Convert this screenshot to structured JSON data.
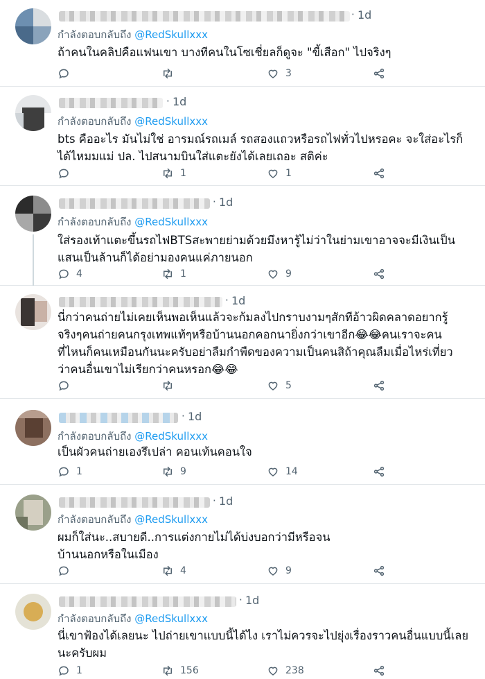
{
  "reply_prefix": "กำลังตอบกลับถึง",
  "reply_handle": "@RedSkullxxx",
  "icons": {
    "reply": "reply-icon",
    "retweet": "retweet-icon",
    "like": "heart-icon",
    "share": "share-icon"
  },
  "colors": {
    "handle": "#1d9bf0",
    "meta": "#536471",
    "text": "#0f1419",
    "divider": "#e3e7ea"
  },
  "tweets": [
    {
      "time": "1d",
      "text": "ถ้าคนในคลิปคือแฟนเขา บางทีคนในโซเชี่ยลก็ดูจะ \"ขี้เสือก\" ไปจริงๆ",
      "replies": "",
      "retweets": "",
      "likes": "3"
    },
    {
      "time": "1d",
      "text": "bts คืออะไร มันไม่ใช่ อารมณ์รถเมล์ รถสองแถวหรือรถไฟทั่วไปหรอคะ จะใส่อะไรก็\nได้ไหมมแม่ ปล. ไปสนามบินใส่แตะยังได้เลยเถอะ สติค่ะ",
      "replies": "",
      "retweets": "1",
      "likes": "1"
    },
    {
      "time": "1d",
      "text": "ใส่รองเท้าแตะขึ้นรถไฟBTSสะพายย่ามด้วยมึงหารู้ไม่ว่าในย่ามเขาอาจจะมีเงินเป็น\nแสนเป็นล้านก็ได้อย่ามองคนแค่ภายนอก",
      "replies": "4",
      "retweets": "1",
      "likes": "9"
    },
    {
      "time": "1d",
      "text": "นี่กว่าคนถ่ายไม่เคยเห็นพอเห็นแล้วจะก้มลงไปกราบงามๆสักทีอ้าวผิดคลาดอยากรู้\nจริงๆคนถ่ายคนกรุงเทพแท้ๆหรือบ้านนอกคอกนายิ่งกว่าเขาอีก😂😂คนเราจะคน\nที่ไหนก็คนเหมือนกันนะครับอย่าลืมกำพืดของความเป็นคนสิถ้าคุณลืมเมื่อไหร่เที่ยว\nว่าคนอื่นเขาไม่เรียกว่าคนหรอก😂😂",
      "replies": "",
      "retweets": "",
      "likes": "5"
    },
    {
      "time": "1d",
      "text": "เป็นผัวคนถ่ายเองรึเปล่า คอนเท้นคอนใจ",
      "replies": "1",
      "retweets": "9",
      "likes": "14"
    },
    {
      "time": "1d",
      "text": "ผมก็ใส่นะ..สบายดี..การแต่งกายไม่ได้บ่งบอกว่ามีหรือจน\nบ้านนอกหรือในเมือง",
      "replies": "",
      "retweets": "4",
      "likes": "9"
    },
    {
      "time": "1d",
      "text": "นี่เขาฟ้องได้เลยนะ ไปถ่ายเขาแบบนี้ได้ไง เราไม่ควรจะไปยุ่งเรื่องราวคนอื่นแบบนี้เลย\nนะครับผม",
      "replies": "1",
      "retweets": "156",
      "likes": "238"
    }
  ]
}
